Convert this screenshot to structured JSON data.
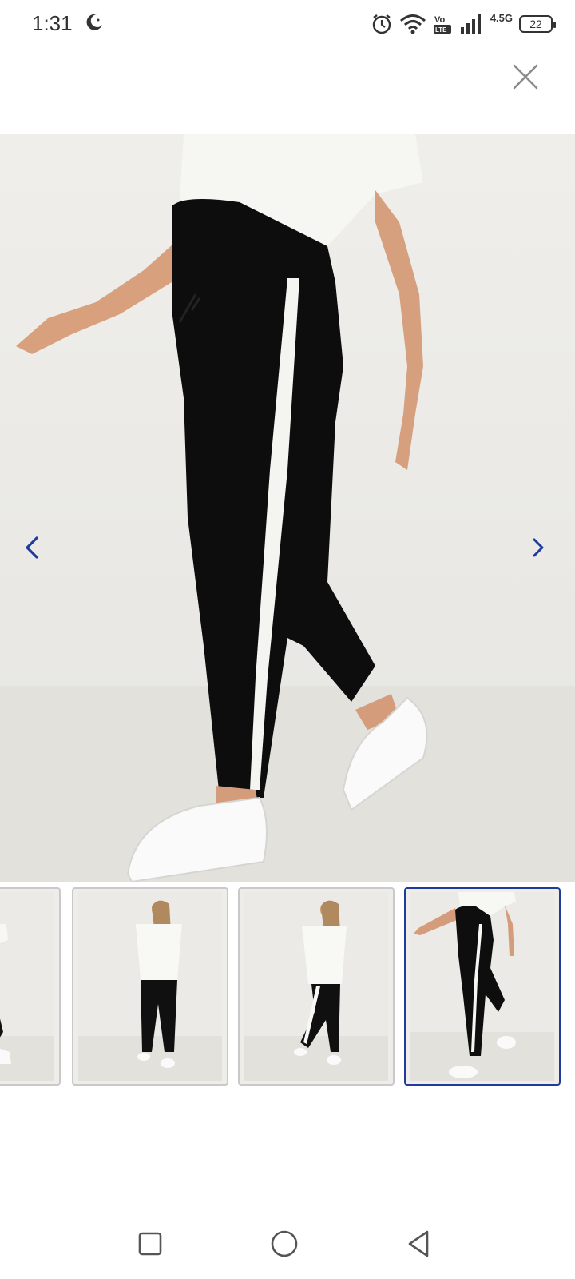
{
  "status_bar": {
    "time": "1:31",
    "network": "4.5G",
    "volte": "Vo LTE",
    "battery": "22"
  },
  "gallery": {
    "close_icon": "close-icon",
    "prev_icon": "chevron-left-icon",
    "next_icon": "chevron-right-icon",
    "accent_color": "#1f3c9c",
    "thumbnails": [
      {
        "name": "thumb-1",
        "selected": false
      },
      {
        "name": "thumb-2",
        "selected": false
      },
      {
        "name": "thumb-3",
        "selected": false
      },
      {
        "name": "thumb-4",
        "selected": true
      }
    ]
  },
  "navbar": {
    "recents_icon": "square-icon",
    "home_icon": "circle-icon",
    "back_icon": "triangle-back-icon"
  }
}
